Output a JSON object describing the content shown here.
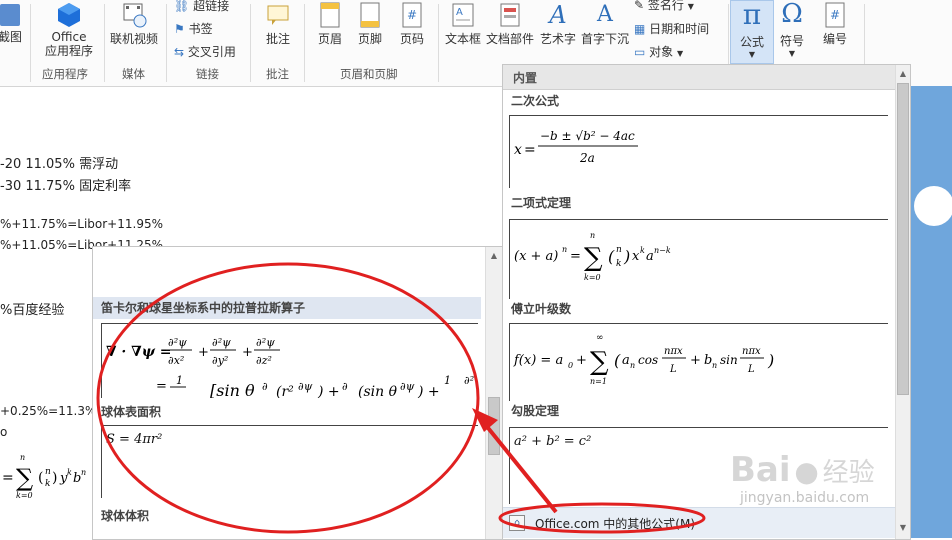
{
  "ribbon": {
    "screenshot_label": "截图",
    "office_apps_label": "Office\n应用程序",
    "online_video_label": "联机视频",
    "hyperlink_label": "超链接",
    "bookmark_label": "书签",
    "crossref_label": "交叉引用",
    "comment_label": "批注",
    "header_label": "页眉",
    "footer_label": "页脚",
    "pagenum_label": "页码",
    "textbox_label": "文本框",
    "docparts_label": "文档部件",
    "wordart_label": "艺术字",
    "dropcap_label": "首字下沉",
    "signature_label": "签名行",
    "datetime_label": "日期和时间",
    "object_label": "对象",
    "equation_label": "公式",
    "symbol_label": "符号",
    "numbering_label": "编号",
    "groups": {
      "apps": "应用程序",
      "media": "媒体",
      "links": "链接",
      "comments": "批注",
      "headerfooter": "页眉和页脚"
    }
  },
  "document": {
    "lines": [
      "-20   11.05%  需浮动",
      "-30   11.75%  固定利率",
      "%+11.75%=Libor+11.95%",
      "%+11.05%=Libor+11.25%",
      "%百度经验",
      "+0.25%=11.3%",
      "o"
    ]
  },
  "back_pane": {
    "sections": [
      {
        "title": "笛卡尔和球星坐标系中的拉普拉斯算子"
      },
      {
        "title": "球体表面积",
        "equation": "S = 4πr²"
      },
      {
        "title": "球体体积"
      }
    ]
  },
  "front_pane": {
    "header": "内置",
    "sections": [
      {
        "title": "二次公式"
      },
      {
        "title": "二项式定理"
      },
      {
        "title": "傅立叶级数"
      },
      {
        "title": "勾股定理",
        "equation": "a² + b² = c²"
      }
    ],
    "more_link": "Office.com 中的其他公式(M)"
  },
  "watermark": {
    "brand": "Bai",
    "brand2": "经验",
    "url": "jingyan.baidu.com"
  },
  "colors": {
    "accent": "#2b579a",
    "annotation": "#e02020",
    "sky": "#6fa6dc"
  }
}
